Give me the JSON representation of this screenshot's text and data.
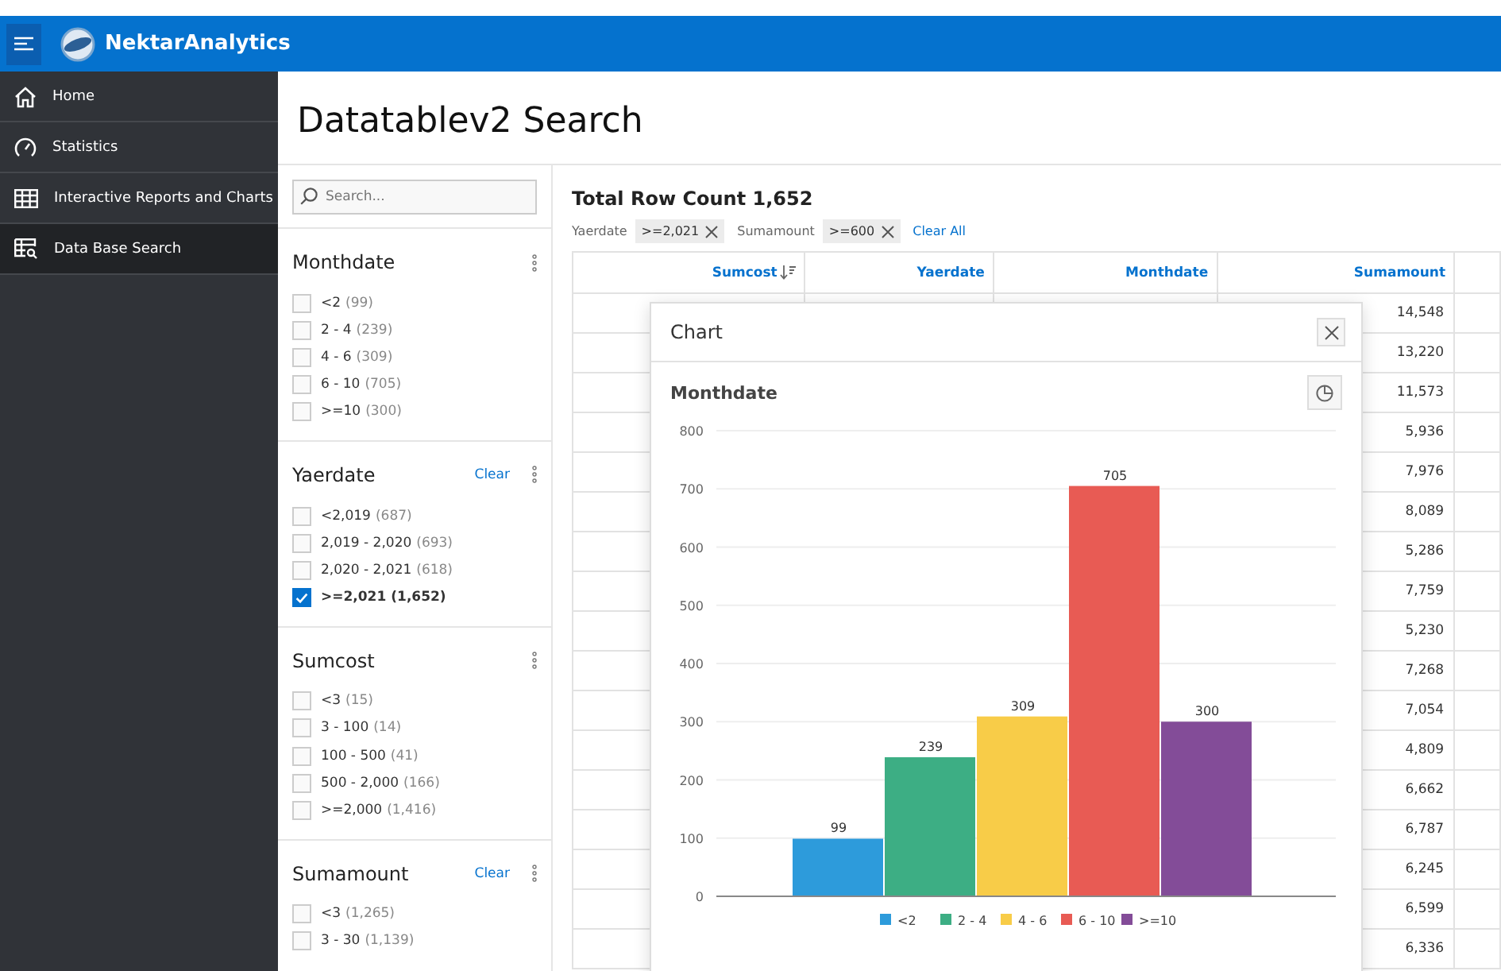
{
  "app": {
    "title": "NektarAnalytics"
  },
  "sidebar": {
    "items": [
      {
        "label": "Home",
        "selected": false
      },
      {
        "label": "Statistics",
        "selected": false
      },
      {
        "label": "Interactive Reports and Charts",
        "selected": false
      },
      {
        "label": "Data Base Search",
        "selected": true
      }
    ]
  },
  "page": {
    "title": "Datatablev2 Search"
  },
  "search": {
    "placeholder": "Search..."
  },
  "facets": [
    {
      "title": "Monthdate",
      "items": [
        {
          "label": "<2",
          "count": "(99)",
          "checked": false
        },
        {
          "label": "2 - 4",
          "count": "(239)",
          "checked": false
        },
        {
          "label": "4 - 6",
          "count": "(309)",
          "checked": false
        },
        {
          "label": "6 - 10",
          "count": "(705)",
          "checked": false
        },
        {
          "label": ">=10",
          "count": "(300)",
          "checked": false
        }
      ]
    },
    {
      "title": "Yaerdate",
      "clear": "Clear",
      "items": [
        {
          "label": "<2,019",
          "count": "(687)",
          "checked": false
        },
        {
          "label": "2,019 - 2,020",
          "count": "(693)",
          "checked": false
        },
        {
          "label": "2,020 - 2,021",
          "count": "(618)",
          "checked": false
        },
        {
          "label": ">=2,021",
          "count": "(1,652)",
          "checked": true
        }
      ]
    },
    {
      "title": "Sumcost",
      "items": [
        {
          "label": "<3",
          "count": "(15)",
          "checked": false
        },
        {
          "label": "3 - 100",
          "count": "(14)",
          "checked": false
        },
        {
          "label": "100 - 500",
          "count": "(41)",
          "checked": false
        },
        {
          "label": "500 - 2,000",
          "count": "(166)",
          "checked": false
        },
        {
          "label": ">=2,000",
          "count": "(1,416)",
          "checked": false
        }
      ]
    },
    {
      "title": "Sumamount",
      "clear": "Clear",
      "items": [
        {
          "label": "<3",
          "count": "(1,265)",
          "checked": false
        },
        {
          "label": "3 - 30",
          "count": "(1,139)",
          "checked": false
        }
      ]
    }
  ],
  "results": {
    "total": "Total Row Count 1,652",
    "filters": [
      {
        "name": "Yaerdate",
        "value": ">=2,021"
      },
      {
        "name": "Sumamount",
        "value": ">=600"
      }
    ],
    "clear_all": "Clear All",
    "columns": [
      {
        "label": "Sumcost",
        "sorted": true
      },
      {
        "label": "Yaerdate",
        "sorted": false
      },
      {
        "label": "Monthdate",
        "sorted": false
      },
      {
        "label": "Sumamount",
        "sorted": false
      }
    ],
    "rows": [
      {
        "sumamount": "14,548"
      },
      {
        "sumamount": "13,220"
      },
      {
        "sumamount": "11,573"
      },
      {
        "sumamount": "5,936"
      },
      {
        "sumamount": "7,976"
      },
      {
        "sumamount": "8,089"
      },
      {
        "sumamount": "5,286"
      },
      {
        "sumamount": "7,759"
      },
      {
        "sumamount": "5,230"
      },
      {
        "sumamount": "7,268"
      },
      {
        "sumamount": "7,054"
      },
      {
        "sumamount": "4,809"
      },
      {
        "sumamount": "6,662"
      },
      {
        "sumamount": "6,787"
      },
      {
        "sumamount": "6,245"
      },
      {
        "sumamount": "6,599"
      },
      {
        "sumamount": "6,336"
      }
    ]
  },
  "dialog": {
    "title": "Chart",
    "chart_title": "Monthdate",
    "chart_data": {
      "type": "bar",
      "ylim": [
        0,
        800
      ],
      "yticks": [
        0,
        100,
        200,
        300,
        400,
        500,
        600,
        700,
        800
      ],
      "data_labels": true,
      "grid": true,
      "legend": true,
      "series": [
        {
          "name": "<2",
          "color": "#2d9bdb",
          "values": [
            99
          ]
        },
        {
          "name": "2 - 4",
          "color": "#3dae84",
          "values": [
            239
          ]
        },
        {
          "name": "4 - 6",
          "color": "#f8cc48",
          "values": [
            309
          ]
        },
        {
          "name": "6 - 10",
          "color": "#e85b54",
          "values": [
            705
          ]
        },
        {
          "name": ">=10",
          "color": "#834c98",
          "values": [
            300
          ]
        }
      ]
    }
  }
}
